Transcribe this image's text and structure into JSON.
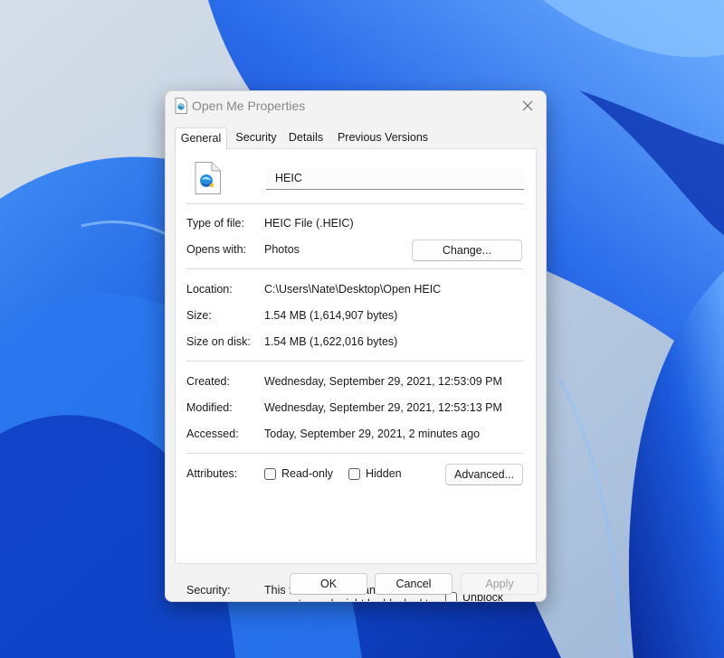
{
  "dialog": {
    "title": "Open Me Properties",
    "title_icon": "heic-file-icon",
    "close_icon": "close-icon"
  },
  "tabs": [
    {
      "label": "General",
      "active": true
    },
    {
      "label": "Security",
      "active": false
    },
    {
      "label": "Details",
      "active": false
    },
    {
      "label": "Previous Versions",
      "active": false
    }
  ],
  "general": {
    "file_icon": "heic-file-icon",
    "file_name": "HEIC",
    "type_of_file_label": "Type of file:",
    "type_of_file_value": "HEIC File (.HEIC)",
    "opens_with_label": "Opens with:",
    "opens_with_value": "Photos",
    "change_button": "Change...",
    "location_label": "Location:",
    "location_value": "C:\\Users\\Nate\\Desktop\\Open HEIC",
    "size_label": "Size:",
    "size_value": "1.54 MB (1,614,907 bytes)",
    "size_on_disk_label": "Size on disk:",
    "size_on_disk_value": "1.54 MB (1,622,016 bytes)",
    "created_label": "Created:",
    "created_value": "Wednesday, September 29, 2021, 12:53:09 PM",
    "modified_label": "Modified:",
    "modified_value": "Wednesday, September 29, 2021, 12:53:13 PM",
    "accessed_label": "Accessed:",
    "accessed_value": "Today, September 29, 2021, 2 minutes ago",
    "attributes_label": "Attributes:",
    "readonly_label": "Read-only",
    "readonly_checked": false,
    "hidden_label": "Hidden",
    "hidden_checked": false,
    "advanced_button": "Advanced...",
    "security_label": "Security:",
    "security_text": "This file came from another\ncomputer and might be blocked to\nhelp protect this computer.",
    "unblock_label": "Unblock",
    "unblock_checked": false
  },
  "footer": {
    "ok": "OK",
    "cancel": "Cancel",
    "apply": "Apply",
    "apply_disabled": true
  },
  "colors": {
    "wallpaper_blue": "#1f5fe0",
    "dialog_bg": "#f3f3f3",
    "panel_bg": "#ffffff"
  }
}
